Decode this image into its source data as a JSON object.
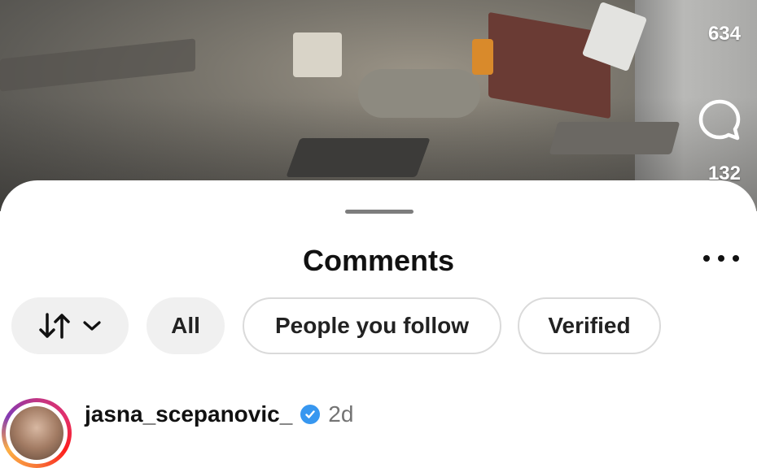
{
  "video_overlay": {
    "likes_count": "634",
    "comments_count": "132"
  },
  "sheet": {
    "title": "Comments"
  },
  "filters": {
    "sort_icon": "sort-arrows-icon",
    "options": [
      {
        "label": "All",
        "selected": true
      },
      {
        "label": "People you follow",
        "selected": false
      },
      {
        "label": "Verified",
        "selected": false
      }
    ]
  },
  "comments": [
    {
      "username": "jasna_scepanovic_",
      "verified": true,
      "time": "2d"
    }
  ],
  "colors": {
    "verified_badge": "#3797f0",
    "chip_selected_bg": "#f0f0f0",
    "chip_border": "#dadada"
  }
}
